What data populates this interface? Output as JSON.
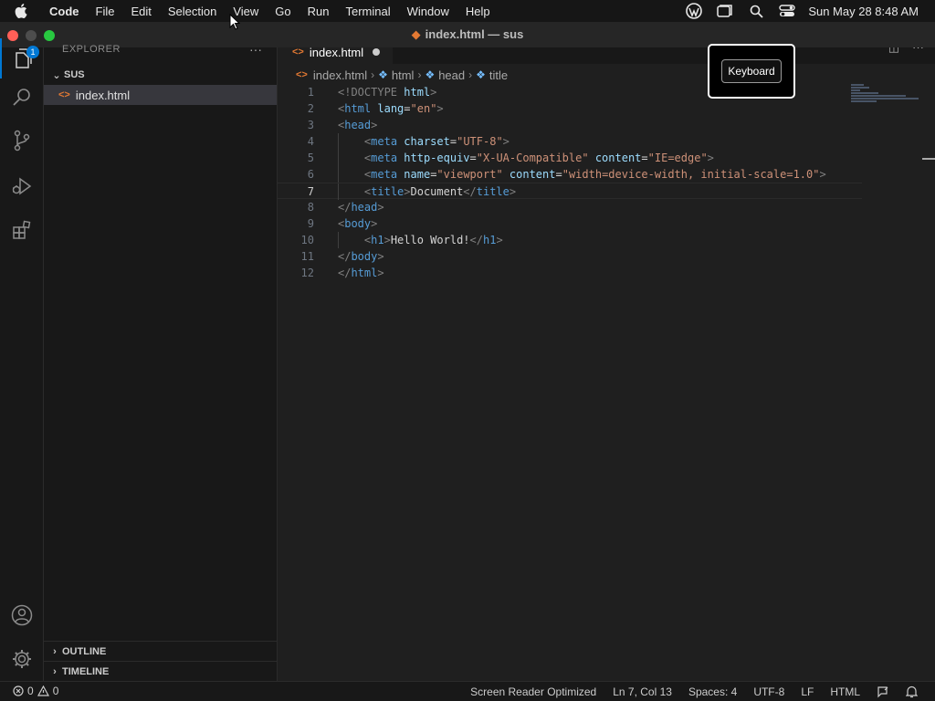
{
  "menubar": {
    "app_name": "Code",
    "items": [
      "File",
      "Edit",
      "Selection",
      "View",
      "Go",
      "Run",
      "Terminal",
      "Window",
      "Help"
    ],
    "clock": "Sun May 28  8:48 AM"
  },
  "window": {
    "title": "index.html — sus"
  },
  "activity_bar": {
    "explorer_badge": "1"
  },
  "sidebar": {
    "header": "EXPLORER",
    "more": "···",
    "folder": "SUS",
    "files": [
      "index.html"
    ],
    "outline": "OUTLINE",
    "timeline": "TIMELINE"
  },
  "editor": {
    "tab": {
      "label": "index.html"
    },
    "tab_actions_more": "···",
    "breadcrumb": [
      "index.html",
      "html",
      "head",
      "title"
    ]
  },
  "overlay": {
    "keyboard_label": "Keyboard"
  },
  "statusbar": {
    "errors": "0",
    "warnings": "0",
    "screen_reader": "Screen Reader Optimized",
    "position": "Ln 7, Col 13",
    "spaces": "Spaces: 4",
    "encoding": "UTF-8",
    "eol": "LF",
    "language": "HTML"
  },
  "colors": {
    "accent": "#0078d4",
    "html_file_icon": "#e37933",
    "tag": "#569cd6",
    "attribute": "#9cdcfe",
    "string": "#ce9178"
  }
}
